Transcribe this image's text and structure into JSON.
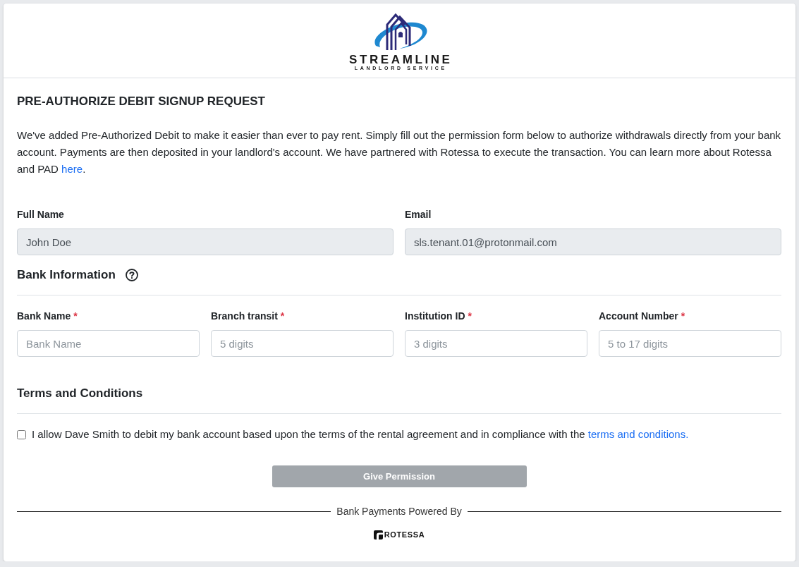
{
  "logo": {
    "name": "STREAMLINE",
    "tagline": "LANDLORD SERVICE"
  },
  "title": "PRE-AUTHORIZE DEBIT SIGNUP REQUEST",
  "intro": {
    "text": "We've added Pre-Authorized Debit to make it easier than ever to pay rent. Simply fill out the permission form below to authorize withdrawals directly from your bank account. Payments are then deposited in your landlord's account. We have partnered with Rotessa to execute the transaction. You can learn more about Rotessa and PAD ",
    "link": "here",
    "after": "."
  },
  "tenant_fields": [
    {
      "label": "Full Name",
      "value": "John Doe",
      "disabled": true
    },
    {
      "label": "Email",
      "value": "sls.tenant.01@protonmail.com",
      "disabled": true
    }
  ],
  "bank_section": {
    "heading": "Bank Information",
    "fields": [
      {
        "label": "Bank Name",
        "required_mark": "*",
        "placeholder": "Bank Name"
      },
      {
        "label": "Branch transit",
        "required_mark": "*",
        "placeholder": "5 digits"
      },
      {
        "label": "Institution ID",
        "required_mark": "*",
        "placeholder": "3 digits"
      },
      {
        "label": "Account Number",
        "required_mark": "*",
        "placeholder": "5 to 17 digits"
      }
    ]
  },
  "terms_section": {
    "heading": "Terms and Conditions",
    "consent": {
      "checked": false,
      "text": "I allow Dave Smith to debit my bank account based upon the terms of the rental agreement and in compliance with the ",
      "link": "terms and conditions."
    }
  },
  "submit_button": {
    "label": "Give Permission",
    "disabled": true
  },
  "footer": {
    "caption": "Bank Payments Powered By",
    "brand": "ROTESSA"
  }
}
